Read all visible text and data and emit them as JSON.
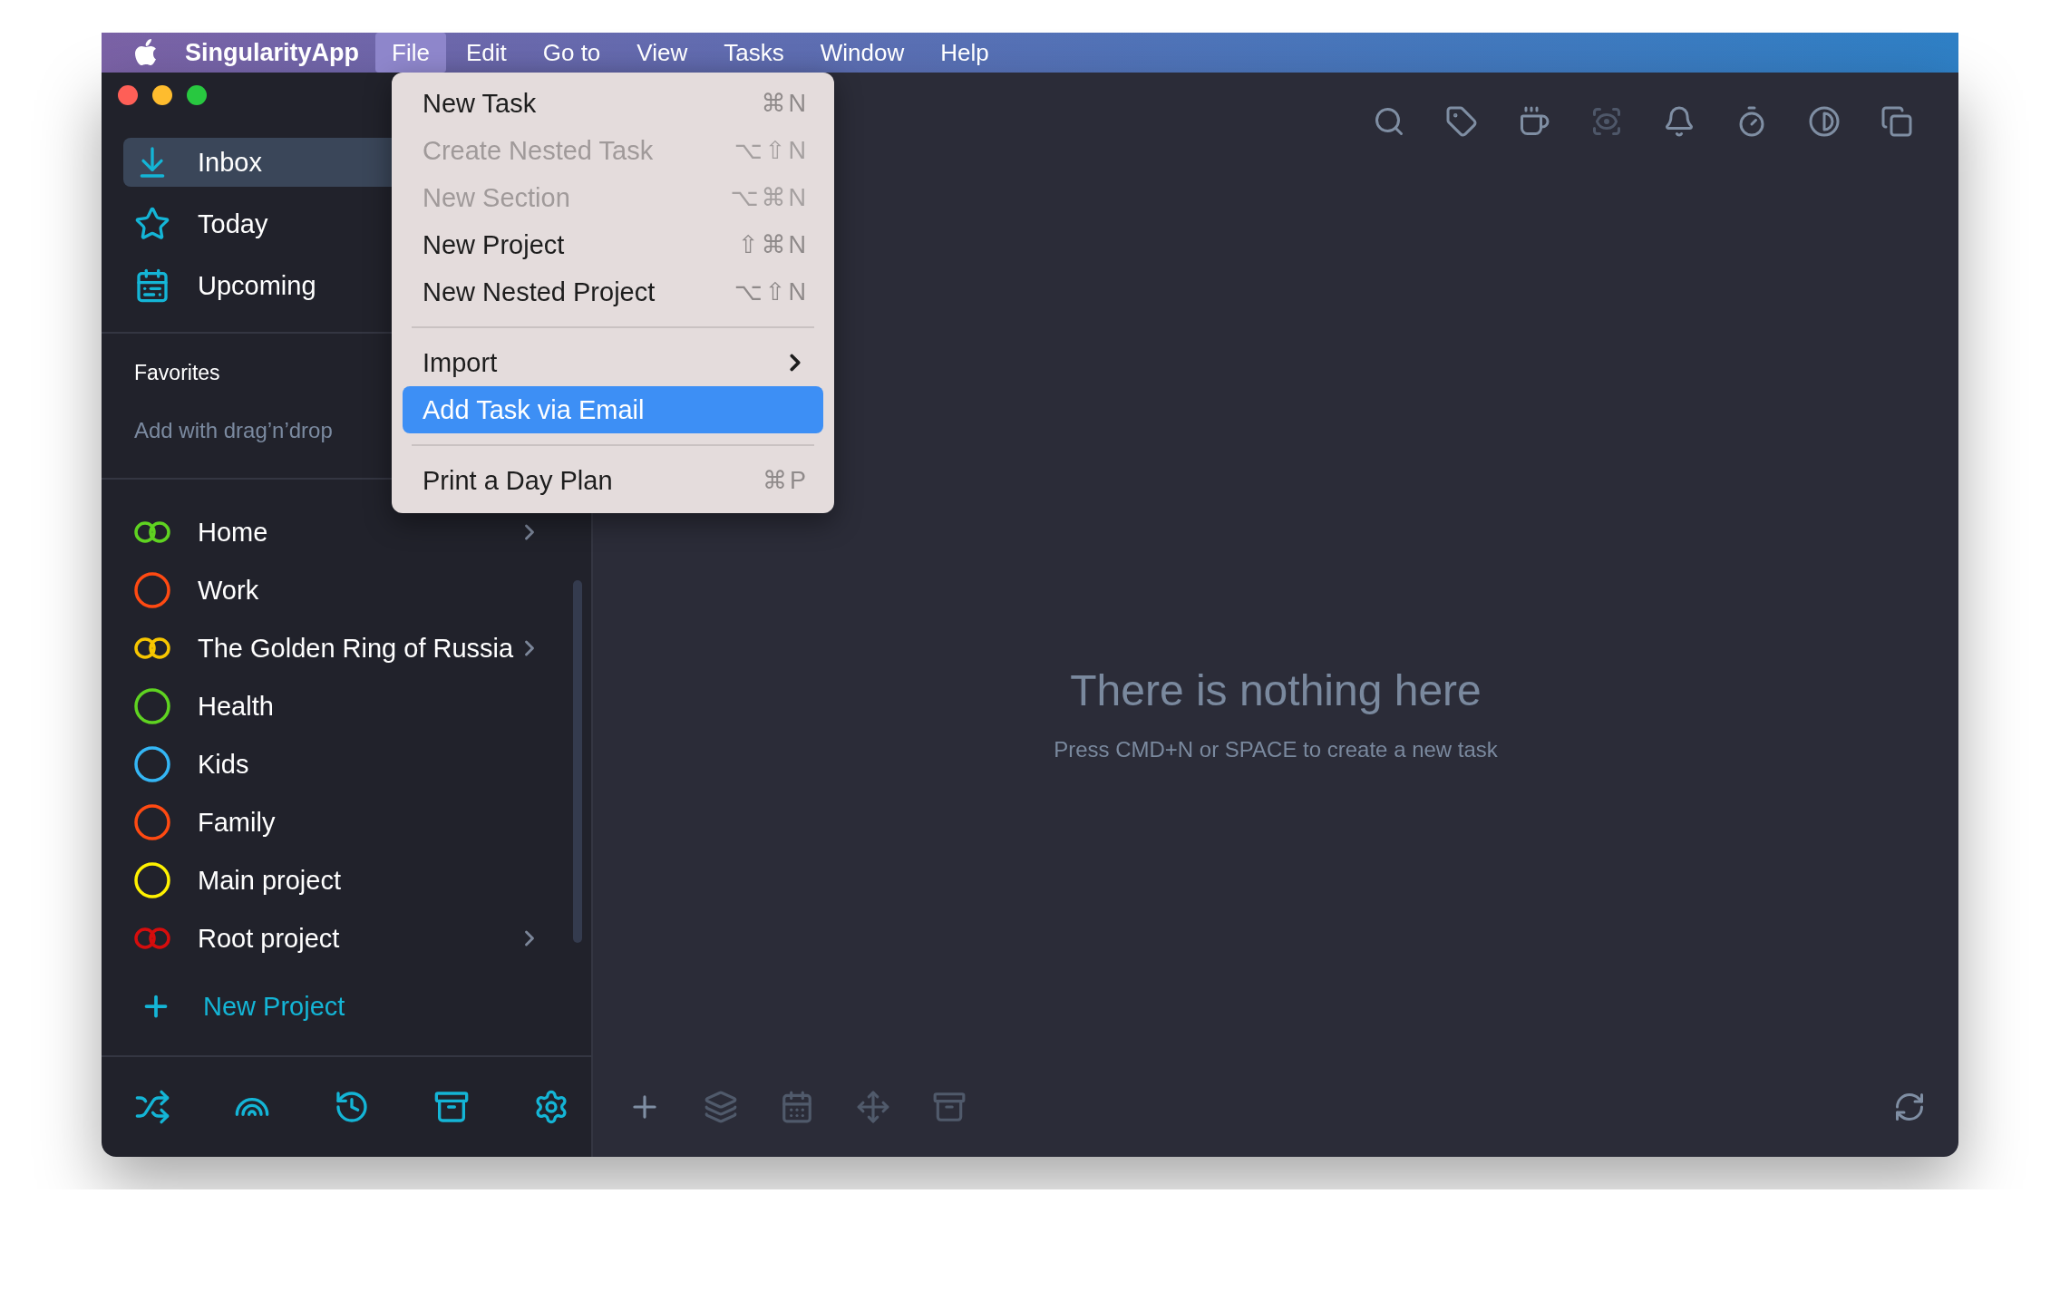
{
  "menubar": {
    "app_name": "SingularityApp",
    "menus": [
      {
        "label": "File",
        "selected": true
      },
      {
        "label": "Edit",
        "selected": false
      },
      {
        "label": "Go to",
        "selected": false
      },
      {
        "label": "View",
        "selected": false
      },
      {
        "label": "Tasks",
        "selected": false
      },
      {
        "label": "Window",
        "selected": false
      },
      {
        "label": "Help",
        "selected": false
      }
    ]
  },
  "file_menu": {
    "items": [
      {
        "kind": "item",
        "label": "New Task",
        "shortcut": "⌘N",
        "disabled": false,
        "selected": false
      },
      {
        "kind": "item",
        "label": "Create Nested Task",
        "shortcut": "⌥⇧N",
        "disabled": true,
        "selected": false
      },
      {
        "kind": "item",
        "label": "New Section",
        "shortcut": "⌥⌘N",
        "disabled": true,
        "selected": false
      },
      {
        "kind": "item",
        "label": "New Project",
        "shortcut": "⇧⌘N",
        "disabled": false,
        "selected": false
      },
      {
        "kind": "item",
        "label": "New Nested Project",
        "shortcut": "⌥⇧N",
        "disabled": false,
        "selected": false
      },
      {
        "kind": "separator"
      },
      {
        "kind": "submenu",
        "label": "Import",
        "disabled": false,
        "selected": false
      },
      {
        "kind": "item",
        "label": "Add Task via Email",
        "disabled": false,
        "selected": true
      },
      {
        "kind": "separator"
      },
      {
        "kind": "item",
        "label": "Print a Day Plan",
        "shortcut": "⌘P",
        "disabled": false,
        "selected": false
      }
    ]
  },
  "sidebar": {
    "nav": [
      {
        "kind": "inbox",
        "label": "Inbox",
        "selected": true
      },
      {
        "kind": "today",
        "label": "Today",
        "selected": false
      },
      {
        "kind": "upcoming",
        "label": "Upcoming",
        "selected": false
      }
    ],
    "favorites": {
      "title": "Favorites",
      "hint": "Add with drag’n’drop"
    },
    "projects": [
      {
        "label": "Home",
        "color": "#5fd321",
        "has_children": true
      },
      {
        "label": "Work",
        "color": "#ff4a12",
        "has_children": false
      },
      {
        "label": "The Golden Ring of Russia",
        "color": "#f7c600",
        "has_children": true
      },
      {
        "label": "Health",
        "color": "#5fd321",
        "has_children": false
      },
      {
        "label": "Kids",
        "color": "#34b6f5",
        "has_children": false
      },
      {
        "label": "Family",
        "color": "#ff4a12",
        "has_children": false
      },
      {
        "label": "Main project",
        "color": "#fff200",
        "has_children": false
      },
      {
        "label": "Root project",
        "color": "#d60d0d",
        "has_children": true
      }
    ],
    "new_project": "New Project"
  },
  "empty_state": {
    "title": "There is nothing here",
    "subtitle": "Press CMD+N or SPACE to create a new task"
  }
}
